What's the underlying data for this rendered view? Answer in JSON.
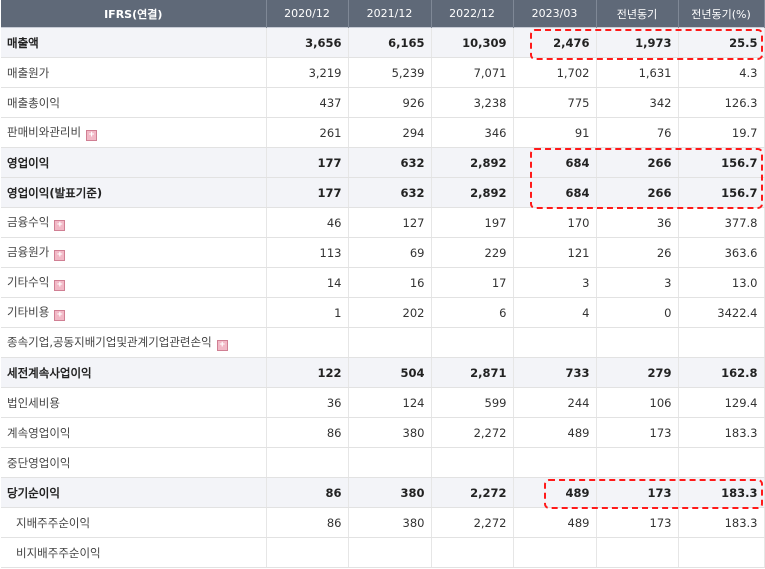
{
  "table": {
    "columns": [
      "IFRS(연결)",
      "2020/12",
      "2021/12",
      "2022/12",
      "2023/03",
      "전년동기",
      "전년동기(%)"
    ],
    "rows": [
      {
        "label": "매출액",
        "values": [
          "3,656",
          "6,165",
          "10,309",
          "2,476",
          "1,973",
          "25.5"
        ],
        "bold": true
      },
      {
        "label": "매출원가",
        "values": [
          "3,219",
          "5,239",
          "7,071",
          "1,702",
          "1,631",
          "4.3"
        ]
      },
      {
        "label": "매출총이익",
        "values": [
          "437",
          "926",
          "3,238",
          "775",
          "342",
          "126.3"
        ]
      },
      {
        "label": "판매비와관리비",
        "values": [
          "261",
          "294",
          "346",
          "91",
          "76",
          "19.7"
        ],
        "expand": true
      },
      {
        "label": "영업이익",
        "values": [
          "177",
          "632",
          "2,892",
          "684",
          "266",
          "156.7"
        ],
        "bold": true
      },
      {
        "label": "영업이익(발표기준)",
        "values": [
          "177",
          "632",
          "2,892",
          "684",
          "266",
          "156.7"
        ],
        "bold": true
      },
      {
        "label": "금융수익",
        "values": [
          "46",
          "127",
          "197",
          "170",
          "36",
          "377.8"
        ],
        "expand": true
      },
      {
        "label": "금융원가",
        "values": [
          "113",
          "69",
          "229",
          "121",
          "26",
          "363.6"
        ],
        "expand": true
      },
      {
        "label": "기타수익",
        "values": [
          "14",
          "16",
          "17",
          "3",
          "3",
          "13.0"
        ],
        "expand": true
      },
      {
        "label": "기타비용",
        "values": [
          "1",
          "202",
          "6",
          "4",
          "0",
          "3422.4"
        ],
        "expand": true
      },
      {
        "label": "종속기업,공동지배기업및관계기업관련손익",
        "values": [
          "",
          "",
          "",
          "",
          "",
          ""
        ],
        "expand": true
      },
      {
        "label": "세전계속사업이익",
        "values": [
          "122",
          "504",
          "2,871",
          "733",
          "279",
          "162.8"
        ],
        "bold": true
      },
      {
        "label": "법인세비용",
        "values": [
          "36",
          "124",
          "599",
          "244",
          "106",
          "129.4"
        ]
      },
      {
        "label": "계속영업이익",
        "values": [
          "86",
          "380",
          "2,272",
          "489",
          "173",
          "183.3"
        ]
      },
      {
        "label": "중단영업이익",
        "values": [
          "",
          "",
          "",
          "",
          "",
          ""
        ]
      },
      {
        "label": "당기순이익",
        "values": [
          "86",
          "380",
          "2,272",
          "489",
          "173",
          "183.3"
        ],
        "bold": true
      },
      {
        "label": "지배주주순이익",
        "values": [
          "86",
          "380",
          "2,272",
          "489",
          "173",
          "183.3"
        ],
        "sub": true
      },
      {
        "label": "비지배주주순이익",
        "values": [
          "",
          "",
          "",
          "",
          "",
          ""
        ],
        "sub": true
      }
    ]
  },
  "expand_icon": "plus-icon",
  "highlight_color": "#ff1a1a"
}
